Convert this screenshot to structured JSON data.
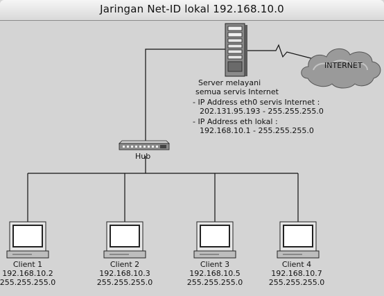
{
  "title": "Jaringan Net-ID lokal 192.168.10.0",
  "cloud": {
    "label": "INTERNET"
  },
  "server": {
    "caption": [
      "Server melayani",
      "semua servis Internet"
    ],
    "details": [
      "- IP Address eth0 servis Internet :",
      "202.131.95.193 -   255.255.255.0",
      "- IP Address eth lokal :",
      "192.168.10.1 -    255.255.255.0"
    ]
  },
  "hub": {
    "label": "Hub"
  },
  "clients": [
    {
      "name": "Client 1",
      "ip": "192.168.10.2",
      "mask": "255.255.255.0"
    },
    {
      "name": "Client 2",
      "ip": "192.168.10.3",
      "mask": "255.255.255.0"
    },
    {
      "name": "Client 3",
      "ip": "192.168.10.5",
      "mask": "255.255.255.0"
    },
    {
      "name": "Client 4",
      "ip": "192.168.10.7",
      "mask": "255.255.255.0"
    }
  ],
  "icons": {
    "server": "server-tower-icon",
    "cloud": "cloud-icon",
    "hub": "network-hub-icon",
    "client": "monitor-icon"
  }
}
